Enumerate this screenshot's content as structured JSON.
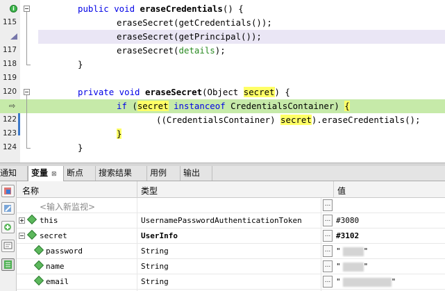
{
  "editor": {
    "lines": [
      {
        "num": "",
        "gutter_icon": "implements-icon",
        "fold": true
      },
      {
        "num": "115"
      },
      {
        "num": "",
        "gutter_icon": "warning-triangle-icon"
      },
      {
        "num": "117"
      },
      {
        "num": "118"
      },
      {
        "num": "119"
      },
      {
        "num": "120",
        "fold": true
      },
      {
        "num": "",
        "gutter_icon": "current-line-arrow-icon"
      },
      {
        "num": "122"
      },
      {
        "num": "123"
      },
      {
        "num": "124"
      }
    ],
    "code": {
      "l0_kw": "public void ",
      "l0_name": "eraseCredentials",
      "l0_rest": "() {",
      "l1": "eraseSecret(getCredentials());",
      "l2": "eraseSecret(getPrincipal());",
      "l3_a": "eraseSecret(",
      "l3_b": "details",
      "l3_c": ");",
      "l4": "}",
      "l6_kw": "private void ",
      "l6_name": "eraseSecret",
      "l6_a": "(Object ",
      "l6_b": "secret",
      "l6_c": ") {",
      "l7_kw1": "if",
      "l7_a": " (",
      "l7_b": "secret",
      "l7_kw2": " instanceof",
      "l7_c": " CredentialsContainer) ",
      "l7_d": "{",
      "l8_a": "((CredentialsContainer) ",
      "l8_b": "secret",
      "l8_c": ").eraseCredentials();",
      "l9": "}",
      "l10": "}"
    }
  },
  "tabs": [
    {
      "label": "通知"
    },
    {
      "label": "变量",
      "close": "⊠",
      "active": true
    },
    {
      "label": "断点"
    },
    {
      "label": "搜索结果"
    },
    {
      "label": "用例"
    },
    {
      "label": "输出"
    }
  ],
  "table": {
    "headers": {
      "name": "名称",
      "type": "类型",
      "value": "值"
    },
    "new_watch_placeholder": "<输入新监视>",
    "rows": [
      {
        "name": "this",
        "type": "UsernamePasswordAuthenticationToken",
        "value": "#3080",
        "expander": "plus",
        "indent": 0
      },
      {
        "name": "secret",
        "type": "UserInfo",
        "value": "#3102",
        "expander": "minus",
        "indent": 0,
        "bold": true
      },
      {
        "name": "password",
        "type": "String",
        "value": "\"",
        "value_end": "\"",
        "indent": 1
      },
      {
        "name": "name",
        "type": "String",
        "value": "\"",
        "value_end": "\"",
        "indent": 1
      },
      {
        "name": "email",
        "type": "String",
        "value": "\"",
        "value_end": "\"",
        "indent": 1
      }
    ],
    "ellipsis": "..."
  },
  "colors": {
    "keyword": "#0000e6",
    "field_green": "#2a8a22",
    "current_line": "#c6eaa9",
    "highlight_line": "#eae6f5",
    "brace_match": "#ffff66"
  }
}
